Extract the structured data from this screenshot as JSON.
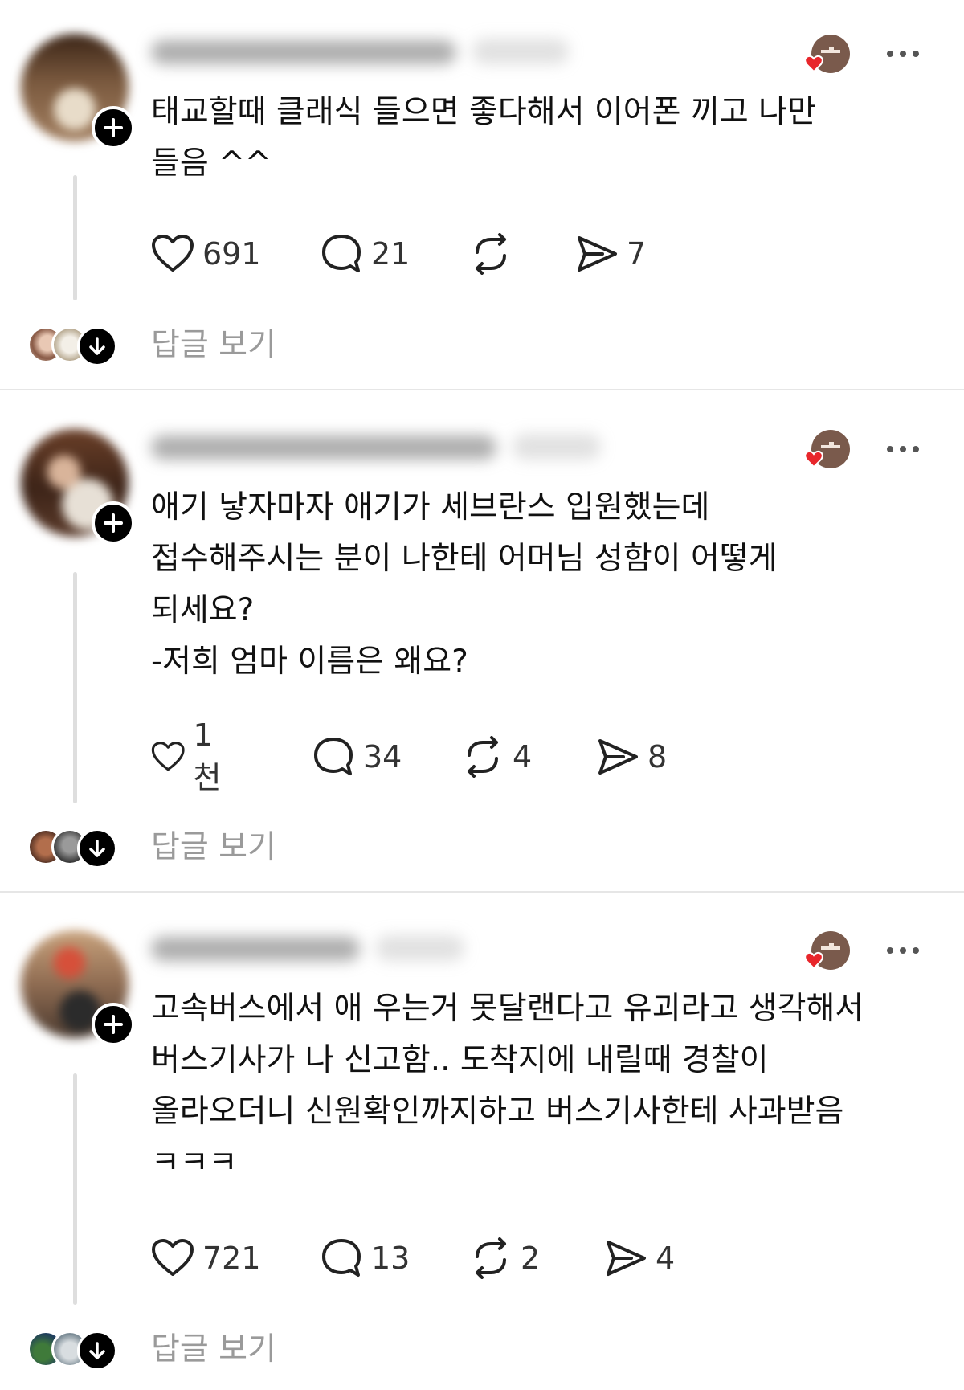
{
  "posts": [
    {
      "text": "태교할때 클래식 들으면 좋다해서 이어폰 끼고 나만\n들음 ^^",
      "likes": "691",
      "comments": "21",
      "reposts": "",
      "shares": "7",
      "view_replies": "답글 보기"
    },
    {
      "text": "애기 낳자마자 애기가 세브란스 입원했는데\n접수해주시는 분이 나한테 어머님 성함이 어떻게\n되세요?\n-저희 엄마 이름은 왜요?",
      "likes": "1천",
      "comments": "34",
      "reposts": "4",
      "shares": "8",
      "view_replies": "답글 보기"
    },
    {
      "text": "고속버스에서 애 우는거 못달랜다고 유괴라고 생각해서\n버스기사가 나 신고함.. 도착지에 내릴때 경찰이\n올라오더니 신원확인까지하고 버스기사한테 사과받음\nㅋㅋㅋ",
      "likes": "721",
      "comments": "13",
      "reposts": "2",
      "shares": "4",
      "view_replies": "답글 보기"
    }
  ],
  "colors": {
    "heart_red": "#e8262b",
    "badge_brown": "#7a5a4c",
    "muted_text": "#9a9a9a",
    "divider": "#e6e6e6"
  },
  "icons": [
    "heart-icon",
    "comment-icon",
    "repost-icon",
    "share-icon",
    "plus-icon",
    "more-icon",
    "arrow-down-icon"
  ]
}
